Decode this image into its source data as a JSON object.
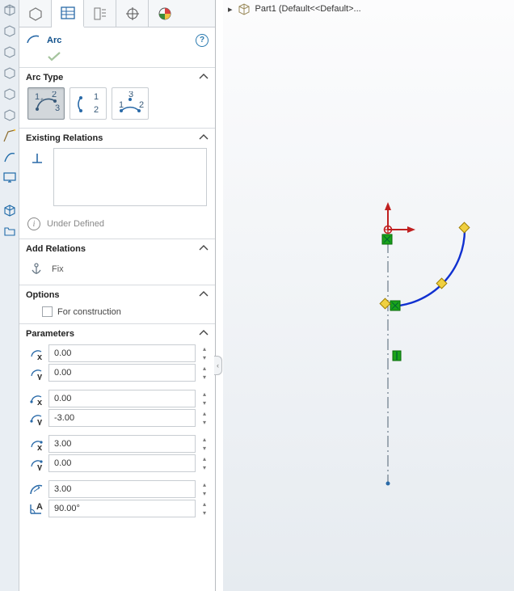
{
  "header": {
    "title": "Arc"
  },
  "sections": {
    "arc_type": {
      "label": "Arc Type"
    },
    "existing_relations": {
      "label": "Existing Relations"
    },
    "under_defined": "Under Defined",
    "add_relations": {
      "label": "Add Relations",
      "fix": "Fix"
    },
    "options": {
      "label": "Options",
      "for_construction": "For construction"
    },
    "parameters": {
      "label": "Parameters"
    }
  },
  "params": {
    "cx": "0.00",
    "cy": "0.00",
    "sx": "0.00",
    "sy": "-3.00",
    "ex": "3.00",
    "ey": "0.00",
    "radius": "3.00",
    "angle": "90.00°"
  },
  "breadcrumb": {
    "part": "Part1 (Default<<Default>..."
  }
}
